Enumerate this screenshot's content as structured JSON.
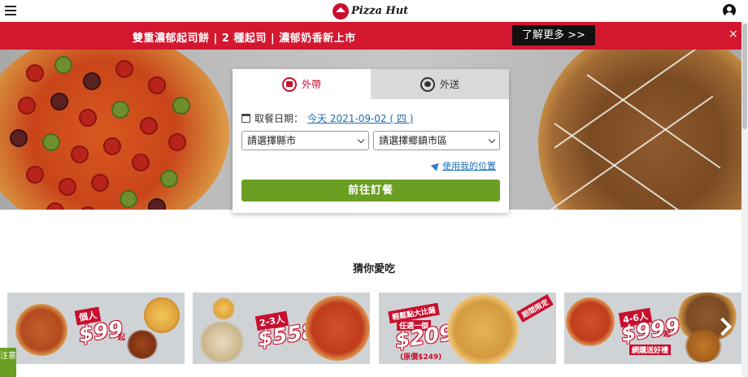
{
  "header": {
    "brand": "Pizza Hut"
  },
  "promo_banner": {
    "text": "雙重濃郁起司餅 | 2 種起司 | 濃郁奶香新上市",
    "button": "了解更多 >>",
    "close": "×"
  },
  "order_card": {
    "tabs": [
      {
        "label": "外帶",
        "icon": "store-icon",
        "active": true
      },
      {
        "label": "外送",
        "icon": "scooter-icon",
        "active": false
      }
    ],
    "date_label": "取餐日期：",
    "date_value": "今天 2021-09-02 ( 四 )",
    "county_select": "請選擇縣市",
    "town_select": "請選擇鄉鎮市區",
    "use_location": "使用我的位置",
    "submit": "前往訂餐"
  },
  "section": {
    "title": "猜你愛吃"
  },
  "promo_cards": [
    {
      "tag": "個人",
      "price": "$99",
      "suffix": "起"
    },
    {
      "tag": "2-3人",
      "price": "$558",
      "suffix": ""
    },
    {
      "tag": "輕鬆點大比薩",
      "price": "$209",
      "sub": "任選一個",
      "note": "(原價$249)",
      "badge": "期間限定"
    },
    {
      "tag": "4-6人",
      "price": "$999",
      "suffix": "起",
      "note": "網購送好禮"
    }
  ],
  "side_tab": "注意",
  "colors": {
    "brand_red": "#c8102e",
    "banner_red": "#d3172f",
    "cta_green": "#6a9f24",
    "link_blue": "#1f6fb5"
  }
}
